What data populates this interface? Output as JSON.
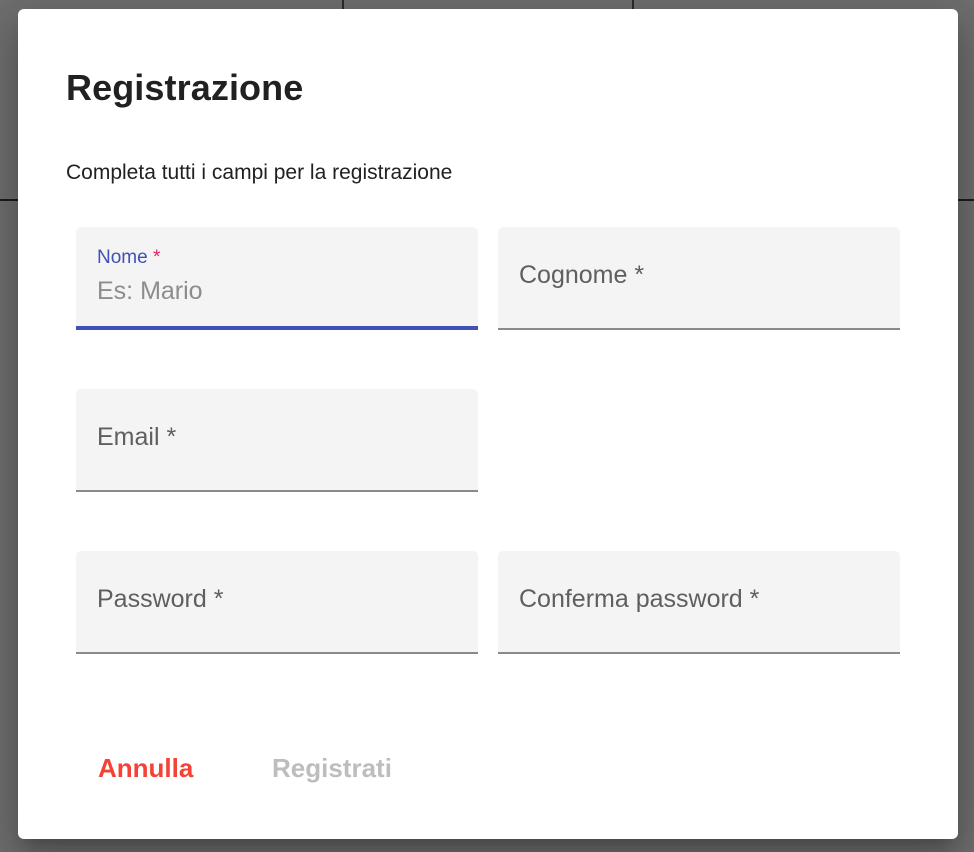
{
  "dialog": {
    "title": "Registrazione",
    "subtitle": "Completa tutti i campi per la registrazione"
  },
  "fields": {
    "nome": {
      "label": "Nome",
      "required_mark": "*",
      "value": "",
      "placeholder": "Es: Mario",
      "focused": true
    },
    "cognome": {
      "label": "Cognome *",
      "value": ""
    },
    "email": {
      "label": "Email *",
      "value": ""
    },
    "password": {
      "label": "Password *",
      "value": ""
    },
    "confirm_password": {
      "label": "Conferma password *",
      "value": ""
    }
  },
  "actions": {
    "cancel_label": "Annulla",
    "submit_label": "Registrati",
    "submit_disabled": true
  },
  "colors": {
    "focus_accent": "#3f51b5",
    "required_star": "#e91e63",
    "cancel_text": "#f44336",
    "disabled_text": "#bdbdbd",
    "field_background": "#f4f4f4"
  }
}
